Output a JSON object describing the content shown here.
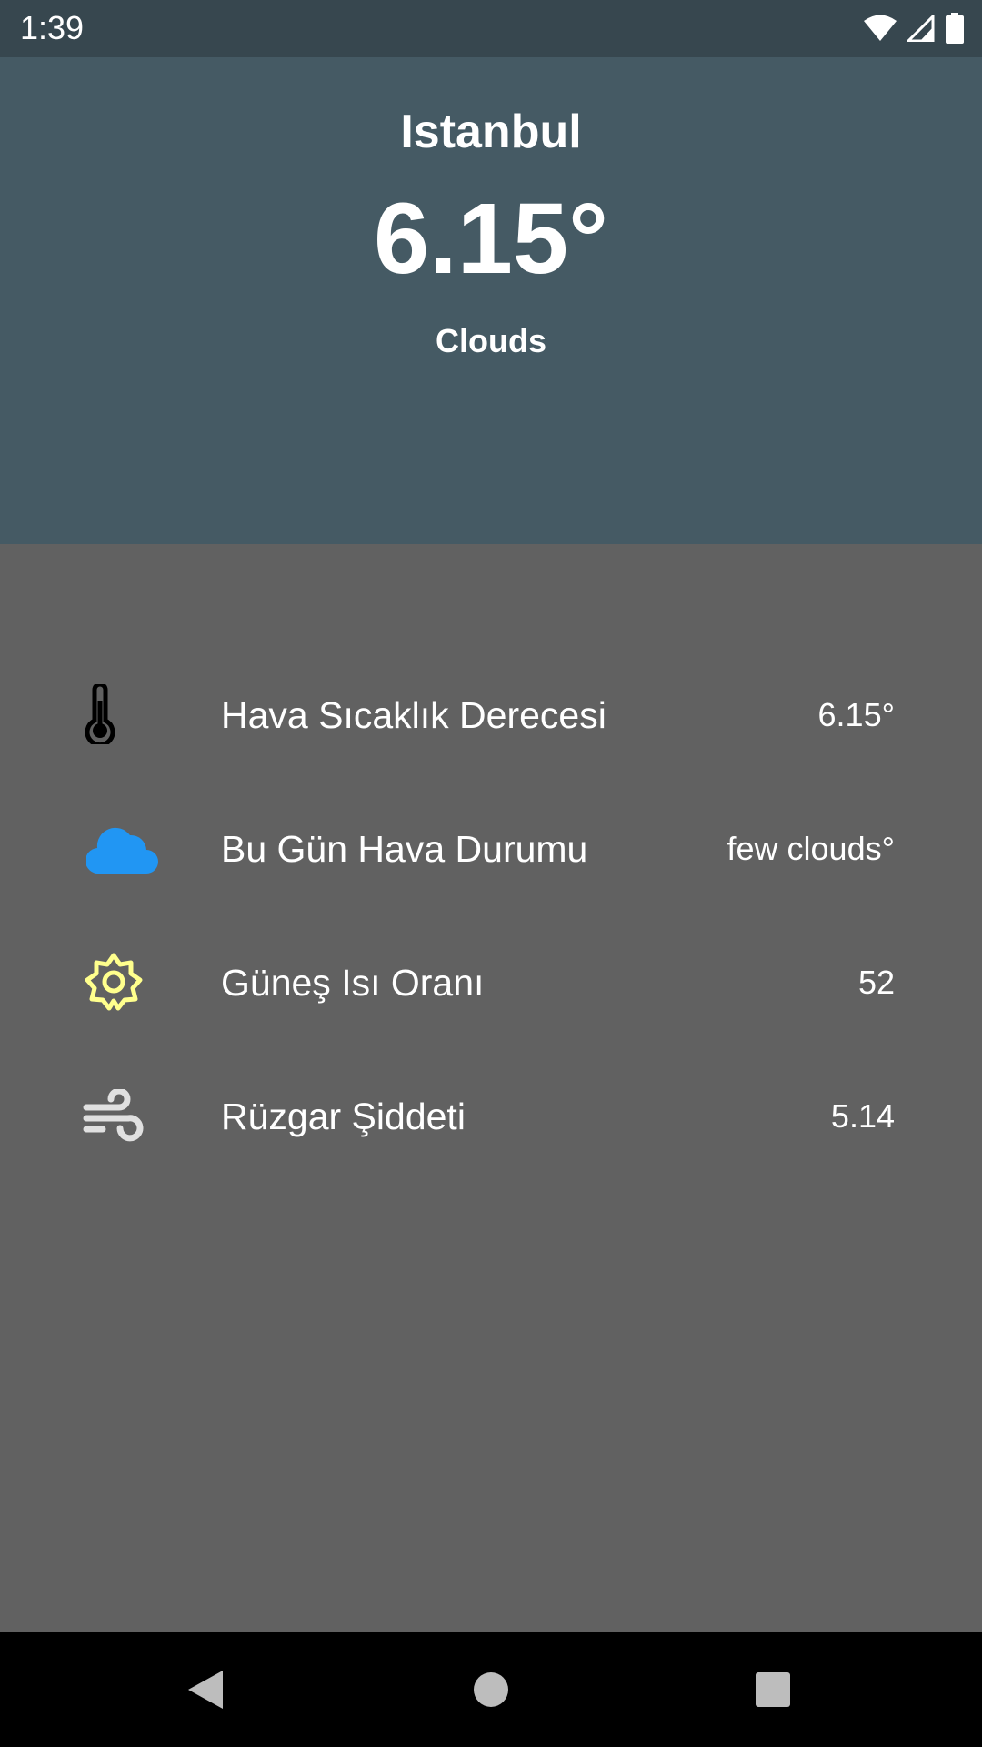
{
  "status_bar": {
    "time": "1:39",
    "icons": [
      "wifi-icon",
      "signal-icon",
      "battery-icon"
    ]
  },
  "header": {
    "city": "Istanbul",
    "temperature": "6.15°",
    "condition": "Clouds",
    "background": "#455a64"
  },
  "details": [
    {
      "icon": "thermometer-icon",
      "label": "Hava Sıcaklık Derecesi",
      "value": "6.15°"
    },
    {
      "icon": "cloud-icon",
      "label": "Bu Gün Hava Durumu",
      "value": "few clouds°"
    },
    {
      "icon": "sun-icon",
      "label": "Güneş Isı Oranı",
      "value": "52"
    },
    {
      "icon": "wind-icon",
      "label": "Rüzgar Şiddeti",
      "value": "5.14"
    }
  ],
  "nav_bar": {
    "buttons": [
      "back-icon",
      "home-icon",
      "recents-icon"
    ]
  },
  "colors": {
    "status_bar": "#37474f",
    "body": "#616161",
    "cloud": "#2196f3",
    "sun": "#ffff8d",
    "wind": "#e0e0e0"
  }
}
